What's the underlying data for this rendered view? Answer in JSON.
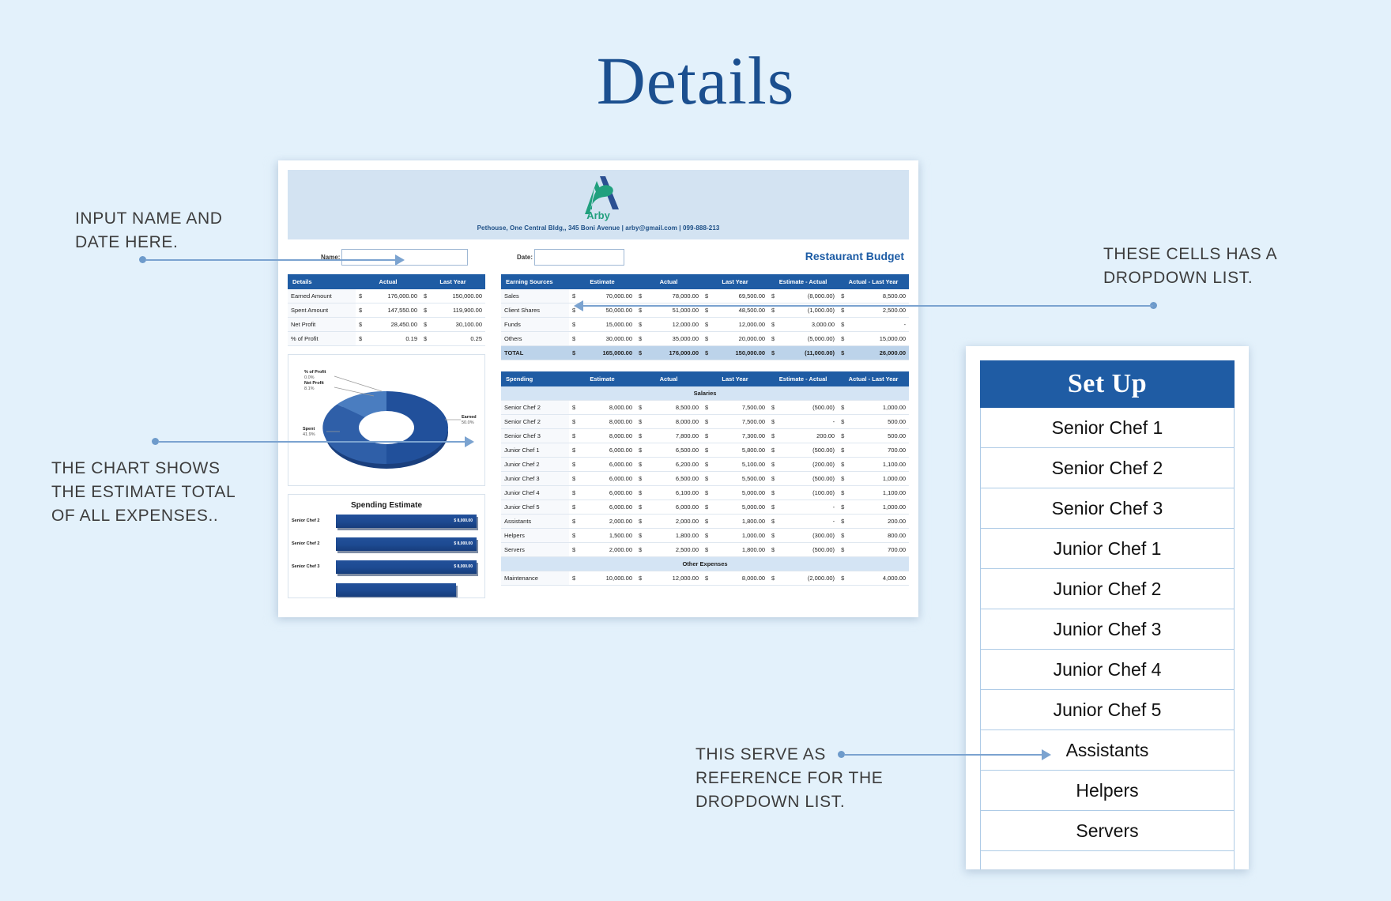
{
  "page": {
    "title": "Details",
    "background_color": "#e3f1fb",
    "accent_color": "#1f5ca4"
  },
  "callouts": [
    {
      "id": "name-date",
      "text": "INPUT NAME AND\nDATE HERE."
    },
    {
      "id": "chart",
      "text": "THE CHART SHOWS\nTHE ESTIMATE TOTAL\nOF ALL EXPENSES.."
    },
    {
      "id": "dropdown-cells",
      "text": "THESE CELLS HAS A\nDROPDOWN LIST."
    },
    {
      "id": "reference",
      "text": "THIS SERVE AS\nREFERENCE FOR THE\nDROPDOWN LIST."
    }
  ],
  "document": {
    "letterhead": {
      "logo_name": "Arby",
      "address": "Pethouse, One Central Bldg,, 345 Boni Avenue | arby@gmail.com | 099-888-213"
    },
    "form": {
      "name_label": "Name:",
      "name_value": "",
      "date_label": "Date:",
      "date_value": "",
      "budget_title": "Restaurant Budget"
    },
    "details_table": {
      "headers": [
        "Details",
        "Actual",
        "Last  Year"
      ],
      "rows": [
        {
          "label": "Earned Amount",
          "actual": "176,000.00",
          "last_year": "150,000.00"
        },
        {
          "label": "Spent Amount",
          "actual": "147,550.00",
          "last_year": "119,900.00"
        },
        {
          "label": "Net Profit",
          "actual": "28,450.00",
          "last_year": "30,100.00"
        },
        {
          "label": "% of Profit",
          "actual": "0.19",
          "last_year": "0.25"
        }
      ]
    },
    "earning_table": {
      "headers": [
        "Earning Sources",
        "Estimate",
        "Actual",
        "Last Year",
        "Estimate - Actual",
        "Actual - Last Year"
      ],
      "rows": [
        {
          "label": "Sales",
          "estimate": "70,000.00",
          "actual": "78,000.00",
          "last_year": "69,500.00",
          "est_act": "(8,000.00)",
          "act_last": "8,500.00"
        },
        {
          "label": "Client Shares",
          "estimate": "50,000.00",
          "actual": "51,000.00",
          "last_year": "48,500.00",
          "est_act": "(1,000.00)",
          "act_last": "2,500.00"
        },
        {
          "label": "Funds",
          "estimate": "15,000.00",
          "actual": "12,000.00",
          "last_year": "12,000.00",
          "est_act": "3,000.00",
          "act_last": "-"
        },
        {
          "label": "Others",
          "estimate": "30,000.00",
          "actual": "35,000.00",
          "last_year": "20,000.00",
          "est_act": "(5,000.00)",
          "act_last": "15,000.00"
        }
      ],
      "total": {
        "label": "TOTAL",
        "estimate": "165,000.00",
        "actual": "176,000.00",
        "last_year": "150,000.00",
        "est_act": "(11,000.00)",
        "act_last": "26,000.00"
      }
    },
    "spending_table": {
      "headers": [
        "Spending",
        "Estimate",
        "Actual",
        "Last Year",
        "Estimate - Actual",
        "Actual - Last Year"
      ],
      "sections": [
        {
          "title": "Salaries",
          "rows": [
            {
              "label": "Senior Chef 2",
              "estimate": "8,000.00",
              "actual": "8,500.00",
              "last_year": "7,500.00",
              "est_act": "(500.00)",
              "act_last": "1,000.00"
            },
            {
              "label": "Senior Chef 2",
              "estimate": "8,000.00",
              "actual": "8,000.00",
              "last_year": "7,500.00",
              "est_act": "-",
              "act_last": "500.00"
            },
            {
              "label": "Senior Chef 3",
              "estimate": "8,000.00",
              "actual": "7,800.00",
              "last_year": "7,300.00",
              "est_act": "200.00",
              "act_last": "500.00"
            },
            {
              "label": "Junior Chef 1",
              "estimate": "6,000.00",
              "actual": "6,500.00",
              "last_year": "5,800.00",
              "est_act": "(500.00)",
              "act_last": "700.00"
            },
            {
              "label": "Junior Chef 2",
              "estimate": "6,000.00",
              "actual": "6,200.00",
              "last_year": "5,100.00",
              "est_act": "(200.00)",
              "act_last": "1,100.00"
            },
            {
              "label": "Junior Chef 3",
              "estimate": "6,000.00",
              "actual": "6,500.00",
              "last_year": "5,500.00",
              "est_act": "(500.00)",
              "act_last": "1,000.00"
            },
            {
              "label": "Junior Chef 4",
              "estimate": "6,000.00",
              "actual": "6,100.00",
              "last_year": "5,000.00",
              "est_act": "(100.00)",
              "act_last": "1,100.00"
            },
            {
              "label": "Junior Chef 5",
              "estimate": "6,000.00",
              "actual": "6,000.00",
              "last_year": "5,000.00",
              "est_act": "-",
              "act_last": "1,000.00"
            },
            {
              "label": "Assistants",
              "estimate": "2,000.00",
              "actual": "2,000.00",
              "last_year": "1,800.00",
              "est_act": "-",
              "act_last": "200.00"
            },
            {
              "label": "Helpers",
              "estimate": "1,500.00",
              "actual": "1,800.00",
              "last_year": "1,000.00",
              "est_act": "(300.00)",
              "act_last": "800.00"
            },
            {
              "label": "Servers",
              "estimate": "2,000.00",
              "actual": "2,500.00",
              "last_year": "1,800.00",
              "est_act": "(500.00)",
              "act_last": "700.00"
            }
          ]
        },
        {
          "title": "Other Expenses",
          "rows": [
            {
              "label": "Maintenance",
              "estimate": "10,000.00",
              "actual": "12,000.00",
              "last_year": "8,000.00",
              "est_act": "(2,000.00)",
              "act_last": "4,000.00"
            }
          ]
        }
      ]
    },
    "charts": [
      {
        "type": "pie",
        "name": "profit-donut",
        "title": "",
        "labels": [
          "% of Profit",
          "Net Profit",
          "Spent",
          "Earned"
        ],
        "values": [
          0.0,
          8.1,
          41.9,
          50.0
        ],
        "value_labels": [
          "0.0%",
          "8.1%",
          "41.9%",
          "50.0%"
        ],
        "donut": true,
        "legend": "labels-outside"
      },
      {
        "type": "bar",
        "name": "spending-estimate",
        "title": "Spending Estimate",
        "orientation": "horizontal",
        "categories": [
          "Senior Chef 2",
          "Senior Chef 2",
          "Senior Chef 3"
        ],
        "values": [
          8000,
          8000,
          8000
        ],
        "value_labels": [
          "$ 8,000.00",
          "$ 8,000.00",
          "$ 8,000.00"
        ],
        "xlabel": "",
        "ylabel": ""
      }
    ]
  },
  "setup_panel": {
    "title": "Set Up",
    "items": [
      "Senior Chef 1",
      "Senior Chef 2",
      "Senior Chef 3",
      "Junior Chef 1",
      "Junior Chef 2",
      "Junior Chef 3",
      "Junior Chef 4",
      "Junior Chef 5",
      "Assistants",
      "Helpers",
      "Servers"
    ]
  }
}
